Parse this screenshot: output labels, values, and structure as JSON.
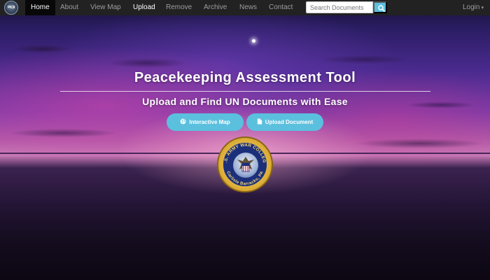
{
  "navbar": {
    "brand_text": "PK3I",
    "items": [
      {
        "label": "Home",
        "active": true
      },
      {
        "label": "About"
      },
      {
        "label": "View Map"
      },
      {
        "label": "Upload"
      },
      {
        "label": "Remove"
      },
      {
        "label": "Archive"
      },
      {
        "label": "News"
      },
      {
        "label": "Contact"
      }
    ],
    "search_placeholder": "Search Documents",
    "search_icon": "search-icon",
    "login_label": "Login"
  },
  "hero": {
    "title": "Peacekeeping Assessment Tool",
    "subtitle": "Upload and Find UN Documents with Ease",
    "buttons": [
      {
        "label": "Interactive Map",
        "icon": "globe-icon"
      },
      {
        "label": "Upload Document",
        "icon": "file-icon"
      }
    ]
  },
  "seal": {
    "top_text": "U.S. ARMY WAR COLLEGE",
    "bottom_text": "Carlisle Barracks, PA"
  },
  "colors": {
    "navbar_bg": "#222222",
    "accent": "#5bc0de",
    "nav_text": "#9d9d9d"
  }
}
